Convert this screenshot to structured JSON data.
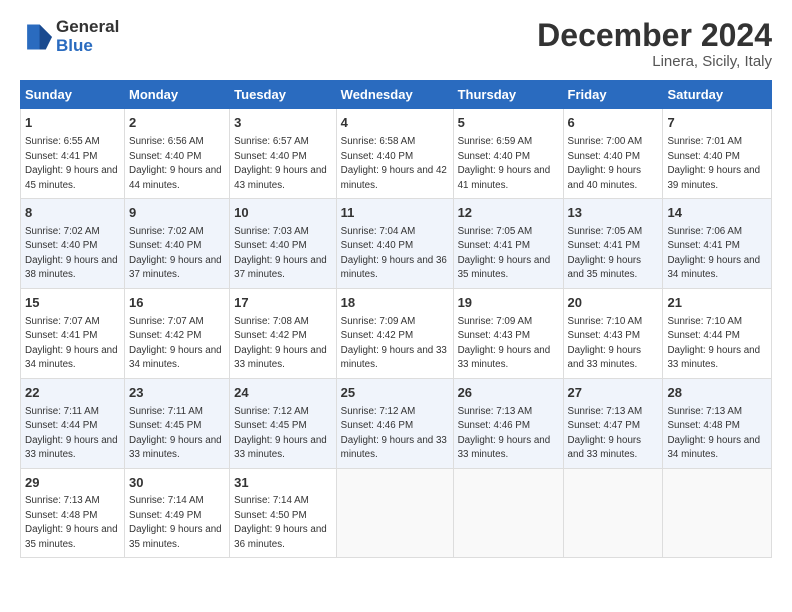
{
  "logo": {
    "general": "General",
    "blue": "Blue"
  },
  "title": "December 2024",
  "subtitle": "Linera, Sicily, Italy",
  "days_header": [
    "Sunday",
    "Monday",
    "Tuesday",
    "Wednesday",
    "Thursday",
    "Friday",
    "Saturday"
  ],
  "weeks": [
    [
      {
        "day": "1",
        "sunrise": "6:55 AM",
        "sunset": "4:41 PM",
        "daylight": "9 hours and 45 minutes."
      },
      {
        "day": "2",
        "sunrise": "6:56 AM",
        "sunset": "4:40 PM",
        "daylight": "9 hours and 44 minutes."
      },
      {
        "day": "3",
        "sunrise": "6:57 AM",
        "sunset": "4:40 PM",
        "daylight": "9 hours and 43 minutes."
      },
      {
        "day": "4",
        "sunrise": "6:58 AM",
        "sunset": "4:40 PM",
        "daylight": "9 hours and 42 minutes."
      },
      {
        "day": "5",
        "sunrise": "6:59 AM",
        "sunset": "4:40 PM",
        "daylight": "9 hours and 41 minutes."
      },
      {
        "day": "6",
        "sunrise": "7:00 AM",
        "sunset": "4:40 PM",
        "daylight": "9 hours and 40 minutes."
      },
      {
        "day": "7",
        "sunrise": "7:01 AM",
        "sunset": "4:40 PM",
        "daylight": "9 hours and 39 minutes."
      }
    ],
    [
      {
        "day": "8",
        "sunrise": "7:02 AM",
        "sunset": "4:40 PM",
        "daylight": "9 hours and 38 minutes."
      },
      {
        "day": "9",
        "sunrise": "7:02 AM",
        "sunset": "4:40 PM",
        "daylight": "9 hours and 37 minutes."
      },
      {
        "day": "10",
        "sunrise": "7:03 AM",
        "sunset": "4:40 PM",
        "daylight": "9 hours and 37 minutes."
      },
      {
        "day": "11",
        "sunrise": "7:04 AM",
        "sunset": "4:40 PM",
        "daylight": "9 hours and 36 minutes."
      },
      {
        "day": "12",
        "sunrise": "7:05 AM",
        "sunset": "4:41 PM",
        "daylight": "9 hours and 35 minutes."
      },
      {
        "day": "13",
        "sunrise": "7:05 AM",
        "sunset": "4:41 PM",
        "daylight": "9 hours and 35 minutes."
      },
      {
        "day": "14",
        "sunrise": "7:06 AM",
        "sunset": "4:41 PM",
        "daylight": "9 hours and 34 minutes."
      }
    ],
    [
      {
        "day": "15",
        "sunrise": "7:07 AM",
        "sunset": "4:41 PM",
        "daylight": "9 hours and 34 minutes."
      },
      {
        "day": "16",
        "sunrise": "7:07 AM",
        "sunset": "4:42 PM",
        "daylight": "9 hours and 34 minutes."
      },
      {
        "day": "17",
        "sunrise": "7:08 AM",
        "sunset": "4:42 PM",
        "daylight": "9 hours and 33 minutes."
      },
      {
        "day": "18",
        "sunrise": "7:09 AM",
        "sunset": "4:42 PM",
        "daylight": "9 hours and 33 minutes."
      },
      {
        "day": "19",
        "sunrise": "7:09 AM",
        "sunset": "4:43 PM",
        "daylight": "9 hours and 33 minutes."
      },
      {
        "day": "20",
        "sunrise": "7:10 AM",
        "sunset": "4:43 PM",
        "daylight": "9 hours and 33 minutes."
      },
      {
        "day": "21",
        "sunrise": "7:10 AM",
        "sunset": "4:44 PM",
        "daylight": "9 hours and 33 minutes."
      }
    ],
    [
      {
        "day": "22",
        "sunrise": "7:11 AM",
        "sunset": "4:44 PM",
        "daylight": "9 hours and 33 minutes."
      },
      {
        "day": "23",
        "sunrise": "7:11 AM",
        "sunset": "4:45 PM",
        "daylight": "9 hours and 33 minutes."
      },
      {
        "day": "24",
        "sunrise": "7:12 AM",
        "sunset": "4:45 PM",
        "daylight": "9 hours and 33 minutes."
      },
      {
        "day": "25",
        "sunrise": "7:12 AM",
        "sunset": "4:46 PM",
        "daylight": "9 hours and 33 minutes."
      },
      {
        "day": "26",
        "sunrise": "7:13 AM",
        "sunset": "4:46 PM",
        "daylight": "9 hours and 33 minutes."
      },
      {
        "day": "27",
        "sunrise": "7:13 AM",
        "sunset": "4:47 PM",
        "daylight": "9 hours and 33 minutes."
      },
      {
        "day": "28",
        "sunrise": "7:13 AM",
        "sunset": "4:48 PM",
        "daylight": "9 hours and 34 minutes."
      }
    ],
    [
      {
        "day": "29",
        "sunrise": "7:13 AM",
        "sunset": "4:48 PM",
        "daylight": "9 hours and 35 minutes."
      },
      {
        "day": "30",
        "sunrise": "7:14 AM",
        "sunset": "4:49 PM",
        "daylight": "9 hours and 35 minutes."
      },
      {
        "day": "31",
        "sunrise": "7:14 AM",
        "sunset": "4:50 PM",
        "daylight": "9 hours and 36 minutes."
      },
      null,
      null,
      null,
      null
    ]
  ]
}
